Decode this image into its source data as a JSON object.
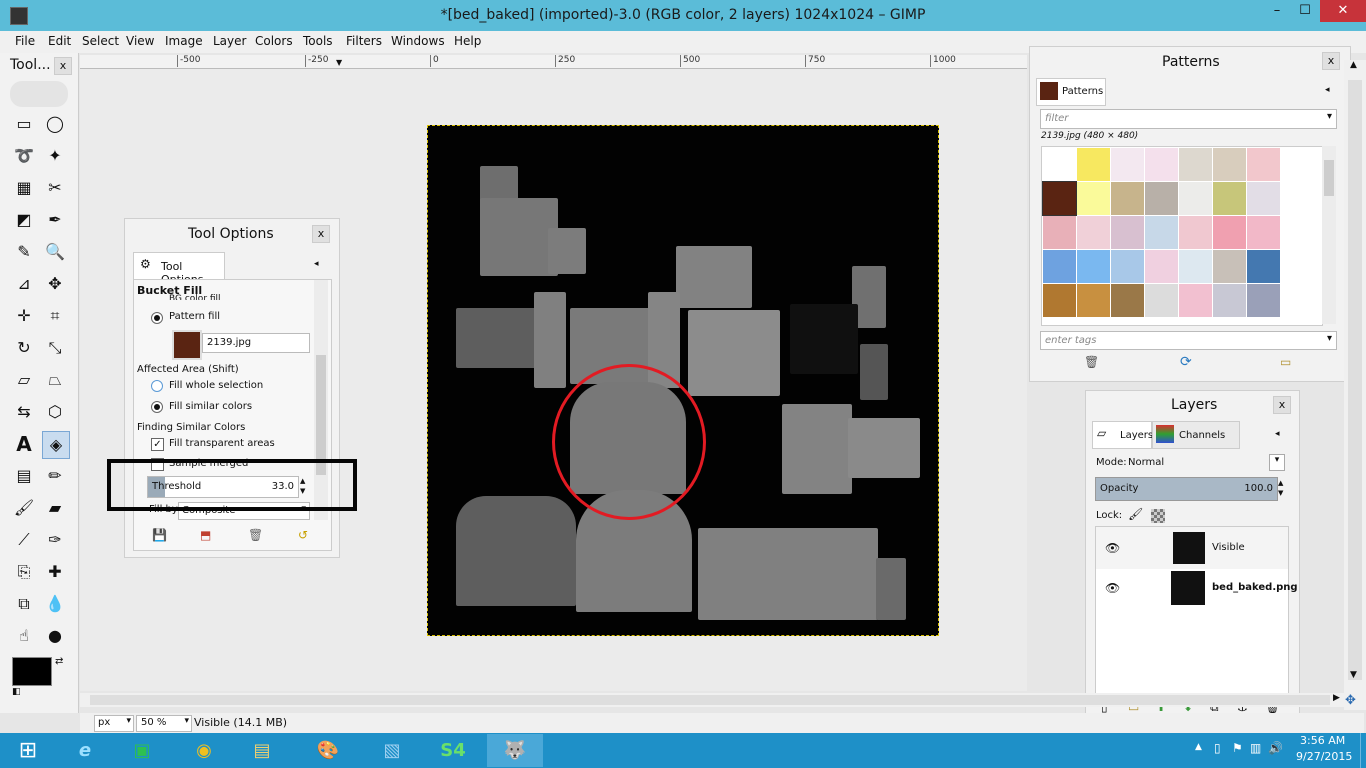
{
  "window": {
    "title": "*[bed_baked] (imported)-3.0 (RGB color, 2 layers) 1024x1024 – GIMP",
    "minimize": "–",
    "maximize": "☐",
    "close": "✕"
  },
  "menu": [
    "File",
    "Edit",
    "Select",
    "View",
    "Image",
    "Layer",
    "Colors",
    "Tools",
    "Filters",
    "Windows",
    "Help"
  ],
  "ruler": {
    "ticks": [
      "-500",
      "-250",
      "0",
      "250",
      "500",
      "750",
      "1000"
    ]
  },
  "toolbox": {
    "title": "Tool..."
  },
  "tool_options": {
    "title": "Tool Options",
    "tab": "Tool Options",
    "section": "Bucket Fill",
    "bg_fill": "BG color fill",
    "pattern_fill": "Pattern fill",
    "pattern_name": "2139.jpg",
    "affected_area": "Affected Area  (Shift)",
    "fill_whole": "Fill whole selection",
    "fill_similar": "Fill similar colors",
    "finding_similar": "Finding Similar Colors",
    "fill_transparent": "Fill transparent areas",
    "sample_merged": "Sample merged",
    "threshold_label": "Threshold",
    "threshold_value": "33.0",
    "fill_by_label": "Fill by:",
    "fill_by_value": "Composite"
  },
  "patterns": {
    "title": "Patterns",
    "tab": "Patterns",
    "filter_placeholder": "filter",
    "selected_info": "2139.jpg (480 × 480)",
    "tags_placeholder": "enter tags",
    "swatch_colors": [
      "#ffffff",
      "#f7e860",
      "#f3e8f0",
      "#f4e0ec",
      "#ddd8cf",
      "#d8cdbd",
      "#f2c7cc",
      "#5a2412",
      "#fafa9a",
      "#c7b48c",
      "#b8b0a8",
      "#ececea",
      "#c7c67a",
      "#e2dde6",
      "#e8b0b8",
      "#f0d0d8",
      "#d8c0d0",
      "#c7d8e8",
      "#f0c8d0",
      "#f0a0b0",
      "#f2b8c8",
      "#6ea2e0",
      "#7ab8f0",
      "#a8c8e8",
      "#f0d0e0",
      "#dde8f0",
      "#c8c0b8",
      "#4478b0",
      "#b07830",
      "#c89040",
      "#9a7848",
      "#dcdcdc",
      "#f2c0d0",
      "#c8c8d4",
      "#9aa0b8"
    ]
  },
  "layers": {
    "title": "Layers",
    "tab_layers": "Layers",
    "tab_channels": "Channels",
    "mode_label": "Mode:",
    "mode_value": "Normal",
    "opacity_label": "Opacity",
    "opacity_value": "100.0",
    "lock_label": "Lock:",
    "items": [
      {
        "name": "Visible"
      },
      {
        "name": "bed_baked.png"
      }
    ]
  },
  "status": {
    "unit": "px",
    "zoom": "50 %",
    "info": "Visible (14.1 MB)"
  },
  "clock": {
    "time": "3:56 AM",
    "date": "9/27/2015"
  },
  "colors": {
    "titlebar": "#5bbcd8",
    "taskbar": "#1e90c8",
    "annotation_red": "#e21b23"
  }
}
